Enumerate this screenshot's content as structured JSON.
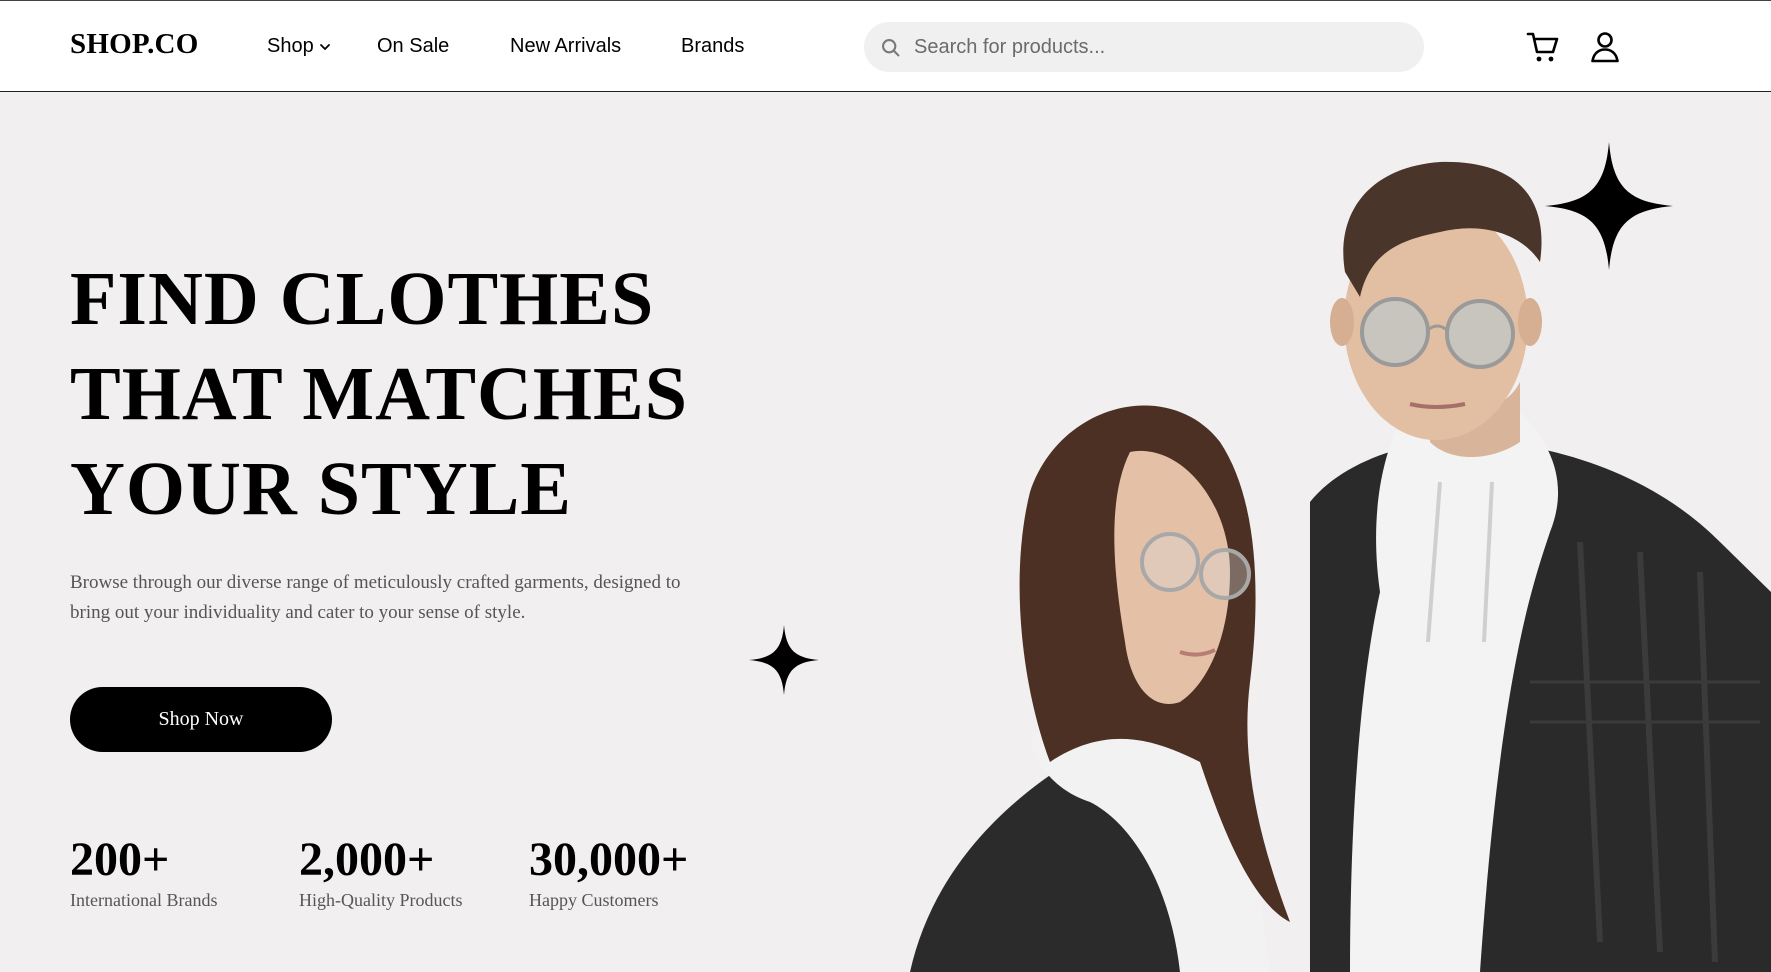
{
  "brand": {
    "logo_text": "SHOP.CO"
  },
  "nav": {
    "items": [
      {
        "label": "Shop",
        "has_dropdown": true
      },
      {
        "label": "On Sale"
      },
      {
        "label": "New Arrivals"
      },
      {
        "label": "Brands"
      }
    ]
  },
  "search": {
    "placeholder": "Search for products...",
    "value": ""
  },
  "header_icons": [
    "cart-icon",
    "user-icon"
  ],
  "hero": {
    "title_lines": [
      "FIND CLOTHES",
      "THAT MATCHES",
      "YOUR STYLE"
    ],
    "description": "Browse through our diverse range of meticulously crafted garments, designed to bring out your individuality and cater to your sense of style.",
    "cta_label": "Shop Now",
    "stats": [
      {
        "value": "200+",
        "label": "International Brands"
      },
      {
        "value": "2,000+",
        "label": "High-Quality Products"
      },
      {
        "value": "30,000+",
        "label": "Happy Customers"
      }
    ]
  },
  "colors": {
    "hero_bg": "#f1eff0",
    "primary": "#000000",
    "search_bg": "#f0f0f0",
    "muted_text": "#555555"
  }
}
